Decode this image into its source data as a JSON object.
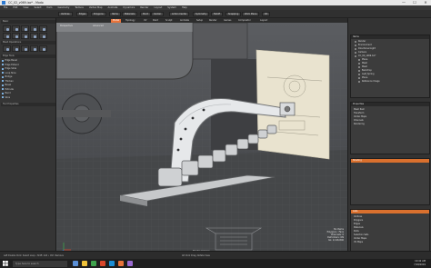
{
  "window": {
    "title": "CC_02_v069.lxo* - Modo",
    "controls": [
      "—",
      "☐",
      "✕"
    ]
  },
  "menubar": {
    "items": [
      "File",
      "Edit",
      "View",
      "Select",
      "Item",
      "Geometry",
      "Texture",
      "Vertex Map",
      "Animate",
      "Dynamics",
      "Render",
      "Layout",
      "System",
      "Help"
    ]
  },
  "toolbar": {
    "buttons": [
      "Vertices",
      "Edges",
      "Polygons",
      "Items",
      "Materials",
      "Pivot",
      "Center",
      "Action Center",
      "Symmetry",
      "Falloff",
      "Snapping",
      "Work Plane",
      "Kit"
    ]
  },
  "modetabs": {
    "tabs": [
      "Model",
      "Topology",
      "UV",
      "Paint",
      "Sculpt",
      "Animate",
      "Setup",
      "Render",
      "Games",
      "Compositor",
      "Layout"
    ],
    "active_index": 0
  },
  "leftpanel": {
    "header": "Basic",
    "section_headers": [
      "Mesh Operations",
      "Edge Tools"
    ],
    "tool_items": [
      "Edge Bevel",
      "Edge Extend",
      "Edge Slide",
      "Loop Slice",
      "Bridge",
      "Thicken",
      "Bevel",
      "Extrude",
      "Bend",
      "Slice"
    ],
    "tool_options_label": "Tool Properties"
  },
  "viewport": {
    "label_top_left": "Perspective",
    "label_render": "Advanced",
    "info_lines": [
      "No Items",
      "Polygons : Face",
      "Channels: 0",
      "Deformers: ON",
      "GL: 2,126,840"
    ],
    "bottom_label": "Render Camera"
  },
  "rightpanel": {
    "header_items": "Items",
    "scene_items": [
      "Render",
      "Environment",
      "Directional Light",
      "Camera",
      "CC_02_v069.lxo*",
      "Plane",
      "Mesh",
      "Mesh",
      "Backdrop",
      "Leaf_Spring",
      "Plane",
      "Reference Image"
    ],
    "properties_header": "Properties",
    "properties_items": [
      "Mesh Item",
      "Transform",
      "Vertex Maps",
      "Channels",
      "Rendering"
    ],
    "shading_header": "Shading",
    "shading_items": [],
    "lists_header": "Lists",
    "list_items": [
      "Vertices",
      "Polygons",
      "Edges",
      "Materials",
      "Parts",
      "Selection Sets",
      "Vertex Maps",
      "UV Maps"
    ]
  },
  "statusbar": {
    "text": "Left Double Click: Select Loop  •  Shift: Add  •  Ctrl: Remove",
    "info": "Alt Click Drag: Rotate View"
  },
  "taskbar": {
    "search_placeholder": "Type here to search",
    "time": "10:42 AM",
    "date": "7/18/2019",
    "icon_colors": [
      "#5a8fd6",
      "#f0c23a",
      "#3fa34d",
      "#d9472b",
      "#1d8fd6",
      "#e8733a",
      "#9a6bd1"
    ]
  }
}
